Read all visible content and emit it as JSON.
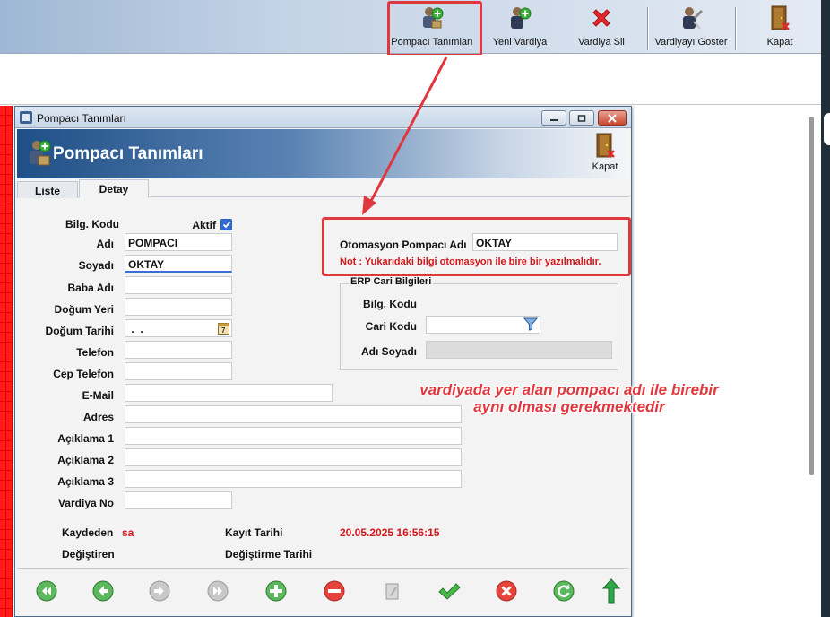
{
  "toolbar": {
    "buttons": [
      {
        "label": "Pompacı Tanımları"
      },
      {
        "label": "Yeni Vardiya"
      },
      {
        "label": "Vardiya Sil"
      },
      {
        "label": "Vardiyayı Goster"
      },
      {
        "label": "Kapat"
      }
    ]
  },
  "dialog": {
    "title": "Pompacı Tanımları",
    "header_title": "Pompacı Tanımları",
    "close_label": "Kapat",
    "tabs": [
      {
        "label": "Liste"
      },
      {
        "label": "Detay"
      }
    ],
    "active_tab": "Detay",
    "form": {
      "bilg_kodu_label": "Bilg. Kodu",
      "aktif_label": "Aktif",
      "aktif_checked": true,
      "adi_label": "Adı",
      "adi_value": "POMPACI",
      "soyadi_label": "Soyadı",
      "soyadi_value": "OKTAY",
      "baba_adi_label": "Baba Adı",
      "baba_adi_value": "",
      "dogum_yeri_label": "Doğum Yeri",
      "dogum_yeri_value": "",
      "dogum_tarihi_label": "Doğum Tarihi",
      "dogum_tarihi_value": " .  .",
      "telefon_label": "Telefon",
      "telefon_value": "",
      "cep_telefon_label": "Cep Telefon",
      "cep_telefon_value": "",
      "email_label": "E-Mail",
      "email_value": "",
      "adres_label": "Adres",
      "adres_value": "",
      "aciklama1_label": "Açıklama 1",
      "aciklama1_value": "",
      "aciklama2_label": "Açıklama 2",
      "aciklama2_value": "",
      "aciklama3_label": "Açıklama 3",
      "aciklama3_value": "",
      "vardiya_no_label": "Vardiya No",
      "vardiya_no_value": "",
      "otomasyon_label": "Otomasyon Pompacı Adı",
      "otomasyon_value": "OKTAY",
      "note": "Not : Yukarıdaki bilgi otomasyon ile bire bir yazılmalıdır.",
      "erp": {
        "title": "ERP Cari Bilgileri",
        "bilg_kodu_label": "Bilg. Kodu",
        "cari_kodu_label": "Cari Kodu",
        "cari_kodu_value": "",
        "adi_soyadi_label": "Adı Soyadı",
        "adi_soyadi_value": ""
      },
      "kaydeden_label": "Kaydeden",
      "kaydeden_value": "sa",
      "kayit_tarihi_label": "Kayıt Tarihi",
      "kayit_tarihi_value": "20.05.2025 16:56:15",
      "degistiren_label": "Değiştiren",
      "degistirme_tarihi_label": "Değiştirme Tarihi"
    }
  },
  "annotation": {
    "line1": "vardiyada yer alan pompacı adı ile birebir",
    "line2": "aynı olması gerekmektedir"
  },
  "colors": {
    "highlight": "#e0383f",
    "accent_blue": "#2f6bd0",
    "red_text": "#d3181b"
  }
}
